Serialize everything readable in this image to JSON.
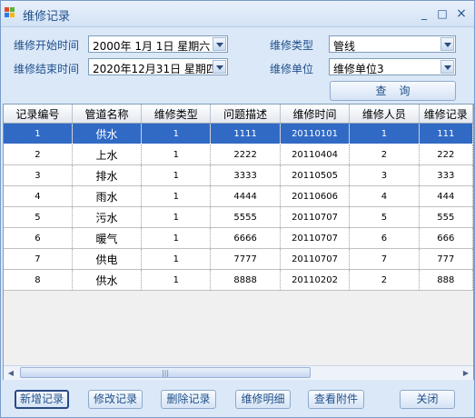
{
  "window": {
    "title": "维修记录",
    "controls": {
      "minimize": "_",
      "maximize": "□",
      "close": "×"
    }
  },
  "filters": {
    "start_label": "维修开始时间",
    "start_value": "2000年  1月  1日  星期六",
    "end_label": "维修结束时间",
    "end_value": "2020年12月31日  星期四",
    "type_label": "维修类型",
    "type_value": "管线",
    "unit_label": "维修单位",
    "unit_value": "维修单位3",
    "query_button": "查询"
  },
  "grid": {
    "columns": [
      "记录编号",
      "管道名称",
      "维修类型",
      "问题描述",
      "维修时间",
      "维修人员",
      "维修记录"
    ],
    "selected_row": 0,
    "rows": [
      [
        "1",
        "供水",
        "1",
        "1111",
        "20110101",
        "1",
        "111"
      ],
      [
        "2",
        "上水",
        "1",
        "2222",
        "20110404",
        "2",
        "222"
      ],
      [
        "3",
        "排水",
        "1",
        "3333",
        "20110505",
        "3",
        "333"
      ],
      [
        "4",
        "雨水",
        "1",
        "4444",
        "20110606",
        "4",
        "444"
      ],
      [
        "5",
        "污水",
        "1",
        "5555",
        "20110707",
        "5",
        "555"
      ],
      [
        "6",
        "暖气",
        "1",
        "6666",
        "20110707",
        "6",
        "666"
      ],
      [
        "7",
        "供电",
        "1",
        "7777",
        "20110707",
        "7",
        "777"
      ],
      [
        "8",
        "供水",
        "1",
        "8888",
        "20110202",
        "2",
        "888"
      ]
    ]
  },
  "buttons": {
    "add": "新增记录",
    "edit": "修改记录",
    "delete": "删除记录",
    "detail": "维修明细",
    "attachments": "查看附件",
    "close": "关闭"
  },
  "icons": {
    "app": "windows-logo-icon",
    "scroll_left": "arrow-left-icon",
    "scroll_right": "arrow-right-icon"
  },
  "colors": {
    "selection": "#316ac5",
    "label": "#1f4f8a",
    "window_bg": "#dbe8f8"
  }
}
